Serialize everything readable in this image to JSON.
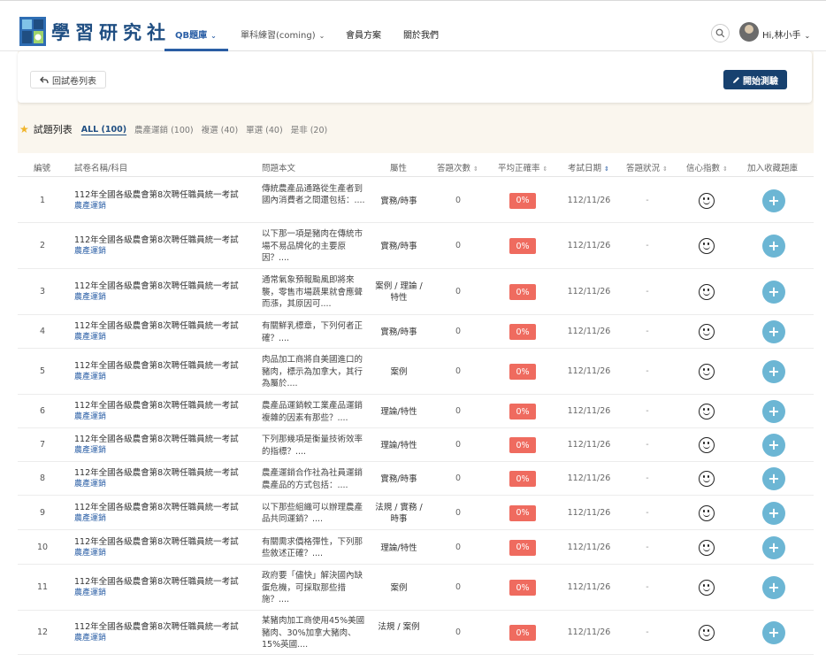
{
  "header": {
    "logo_text": "學習研究社",
    "nav": [
      {
        "label": "QB題庫",
        "chevron": "⌄"
      },
      {
        "label": "單科練習(coming)",
        "chevron": "⌄"
      },
      {
        "label": "會員方案"
      },
      {
        "label": "關於我們"
      }
    ],
    "user_greeting": "Hi,林小手"
  },
  "toolbar": {
    "back_label": "回試卷列表",
    "start_label": "開始測驗"
  },
  "tabs": {
    "title": "試題列表",
    "items": [
      "ALL (100)",
      "農產運銷 (100)",
      "複選 (40)",
      "單選 (40)",
      "是非 (20)"
    ],
    "active": "ALL (100)"
  },
  "table": {
    "columns": [
      "編號",
      "試卷名稱/科目",
      "問題本文",
      "屬性",
      "答題次數",
      "平均正確率",
      "考試日期",
      "答題狀況",
      "信心指數",
      "加入收藏題庫"
    ],
    "rows": [
      {
        "no": "1",
        "exam": "112年全國各級農會第8次聘任職員統一考試",
        "subject": "農產運銷",
        "question": "傳統農產品通路從生產者到國內消費者之間還包括：....",
        "attr": "實務/時事",
        "count": "0",
        "rate": "0%",
        "date": "112/11/26",
        "status": "-"
      },
      {
        "no": "2",
        "exam": "112年全國各級農會第8次聘任職員統一考試",
        "subject": "農產運銷",
        "question": "以下那一項是豬肉在傳統市場不易品牌化的主要原因？....",
        "attr": "實務/時事",
        "count": "0",
        "rate": "0%",
        "date": "112/11/26",
        "status": "-"
      },
      {
        "no": "3",
        "exam": "112年全國各級農會第8次聘任職員統一考試",
        "subject": "農產運銷",
        "question": "通常氣象預報颱風即將來襲，零售市場蔬果就會應聲而漲，其原因可....",
        "attr": "案例 / 理論 / 特性",
        "count": "0",
        "rate": "0%",
        "date": "112/11/26",
        "status": "-"
      },
      {
        "no": "4",
        "exam": "112年全國各級農會第8次聘任職員統一考試",
        "subject": "農產運銷",
        "question": "有關鮮乳標章，下列何者正確？....",
        "attr": "實務/時事",
        "count": "0",
        "rate": "0%",
        "date": "112/11/26",
        "status": "-"
      },
      {
        "no": "5",
        "exam": "112年全國各級農會第8次聘任職員統一考試",
        "subject": "農產運銷",
        "question": "肉品加工商將自美國進口的豬肉，標示為加拿大，其行為屬於....",
        "attr": "案例",
        "count": "0",
        "rate": "0%",
        "date": "112/11/26",
        "status": "-"
      },
      {
        "no": "6",
        "exam": "112年全國各級農會第8次聘任職員統一考試",
        "subject": "農產運銷",
        "question": "農產品運銷較工業產品運銷複雜的因素有那些？....",
        "attr": "理論/特性",
        "count": "0",
        "rate": "0%",
        "date": "112/11/26",
        "status": "-"
      },
      {
        "no": "7",
        "exam": "112年全國各級農會第8次聘任職員統一考試",
        "subject": "農產運銷",
        "question": "下列那幾項是衡量技術效率的指標？....",
        "attr": "理論/特性",
        "count": "0",
        "rate": "0%",
        "date": "112/11/26",
        "status": "-"
      },
      {
        "no": "8",
        "exam": "112年全國各級農會第8次聘任職員統一考試",
        "subject": "農產運銷",
        "question": "農產運銷合作社為社員運銷農產品的方式包括：....",
        "attr": "實務/時事",
        "count": "0",
        "rate": "0%",
        "date": "112/11/26",
        "status": "-"
      },
      {
        "no": "9",
        "exam": "112年全國各級農會第8次聘任職員統一考試",
        "subject": "農產運銷",
        "question": "以下那些組織可以辦理農產品共同運銷？....",
        "attr": "法規 / 實務 / 時事",
        "count": "0",
        "rate": "0%",
        "date": "112/11/26",
        "status": "-"
      },
      {
        "no": "10",
        "exam": "112年全國各級農會第8次聘任職員統一考試",
        "subject": "農產運銷",
        "question": "有關需求價格彈性，下列那些敘述正確？....",
        "attr": "理論/特性",
        "count": "0",
        "rate": "0%",
        "date": "112/11/26",
        "status": "-"
      },
      {
        "no": "11",
        "exam": "112年全國各級農會第8次聘任職員統一考試",
        "subject": "農產運銷",
        "question": "政府要「儘快」解決國內缺蛋危機，可採取那些措施？....",
        "attr": "案例",
        "count": "0",
        "rate": "0%",
        "date": "112/11/26",
        "status": "-"
      },
      {
        "no": "12",
        "exam": "112年全國各級農會第8次聘任職員統一考試",
        "subject": "農產運銷",
        "question": "某豬肉加工商使用45%美國豬肉、30%加拿大豬肉、15%英國....",
        "attr": "法規 / 案例",
        "count": "0",
        "rate": "0%",
        "date": "112/11/26",
        "status": "-"
      }
    ]
  },
  "icons": {
    "back": "arrow-back-icon",
    "start": "pencil-icon",
    "search": "search-icon",
    "star": "star-icon",
    "confidence": "smiley-face-icon",
    "add": "plus-circle-icon"
  },
  "colors": {
    "brand": "#1f4e82",
    "start_button": "#17416f",
    "rate_badge": "#ef6b5f",
    "add_button": "#6cb6d4",
    "subject_text": "#2b5fa6",
    "band_background": "#faf6ee"
  }
}
